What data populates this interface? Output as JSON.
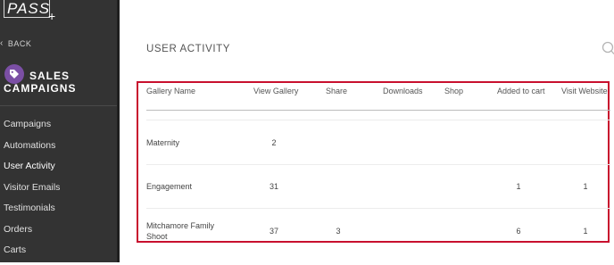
{
  "sidebar": {
    "logo": "PASS",
    "logo_plus": "+",
    "back_label": "BACK",
    "campaign": {
      "line1": "SALES",
      "line2": "CAMPAIGNS",
      "badge_color": "#7b4fa5"
    },
    "items": [
      {
        "label": "Campaigns"
      },
      {
        "label": "Automations"
      },
      {
        "label": "User Activity"
      },
      {
        "label": "Visitor Emails"
      },
      {
        "label": "Testimonials"
      },
      {
        "label": "Orders"
      },
      {
        "label": "Carts"
      }
    ]
  },
  "main": {
    "title": "USER ACTIVITY",
    "table": {
      "columns": [
        "Gallery Name",
        "View Gallery",
        "Share",
        "Downloads",
        "Shop",
        "Added to cart",
        "Visit Website"
      ],
      "rows": [
        {
          "name": "Maternity",
          "view": "2",
          "share": "",
          "downloads": "",
          "shop": "",
          "cart": "",
          "visit": ""
        },
        {
          "name": "Engagement",
          "view": "31",
          "share": "",
          "downloads": "",
          "shop": "",
          "cart": "1",
          "visit": "1"
        },
        {
          "name": "Mitchamore Family Shoot",
          "view": "37",
          "share": "3",
          "downloads": "",
          "shop": "",
          "cart": "6",
          "visit": "1"
        }
      ]
    }
  },
  "colors": {
    "sidebar_bg": "#333333",
    "highlight_border": "#c8102e"
  }
}
